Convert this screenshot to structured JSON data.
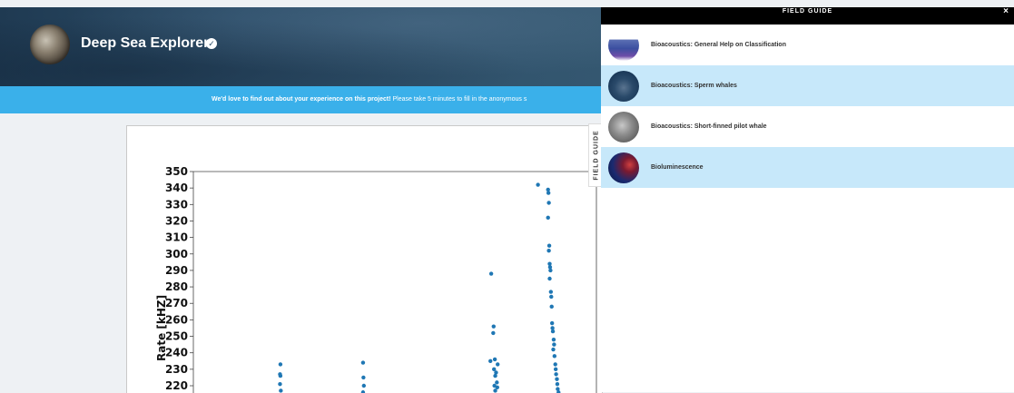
{
  "header": {
    "project_title": "Deep Sea Explorers",
    "verified_icon": "check-circle-icon"
  },
  "banner": {
    "bold_text": "We'd love to find out about your experience on this project!",
    "text": " Please take 5 minutes to fill in the anonymous s"
  },
  "field_guide_tab": {
    "label": "FIELD GUIDE"
  },
  "field_guide": {
    "title": "FIELD GUIDE",
    "close_label": "×",
    "items": [
      {
        "label": "Bioacoustics: General Help on Classification"
      },
      {
        "label": "Bioacoustics: Sperm whales"
      },
      {
        "label": "Bioacoustics: Short-finned pilot whale"
      },
      {
        "label": "Bioluminescence"
      }
    ]
  },
  "colors": {
    "banner": "#3ab0ea",
    "point": "#1f77b4",
    "highlight_row": "#c7e8fa"
  },
  "chart_data": {
    "type": "scatter",
    "ylabel": "Rate [kHZ]",
    "xlabel": "",
    "yticks": [
      220,
      230,
      240,
      250,
      260,
      270,
      280,
      290,
      300,
      310,
      320,
      330,
      340,
      350
    ],
    "ylim": [
      214,
      350
    ],
    "xlim": [
      0,
      100
    ],
    "series": [
      {
        "points": [
          [
            21.6,
            233
          ],
          [
            21.5,
            227
          ],
          [
            21.6,
            226
          ],
          [
            21.5,
            221
          ],
          [
            21.7,
            217
          ],
          [
            42.1,
            234
          ],
          [
            42.2,
            225
          ],
          [
            42.3,
            220
          ],
          [
            42.1,
            216
          ],
          [
            73.9,
            288
          ],
          [
            74.5,
            256
          ],
          [
            74.4,
            252
          ],
          [
            73.7,
            235
          ],
          [
            74.8,
            236
          ],
          [
            75.5,
            233
          ],
          [
            74.6,
            230
          ],
          [
            75.1,
            228
          ],
          [
            74.9,
            226
          ],
          [
            75.3,
            222
          ],
          [
            74.7,
            220
          ],
          [
            75.4,
            219
          ],
          [
            74.9,
            217
          ],
          [
            85.5,
            342
          ],
          [
            88.0,
            339
          ],
          [
            88.1,
            337
          ],
          [
            88.2,
            331
          ],
          [
            88.0,
            322
          ],
          [
            88.3,
            305
          ],
          [
            88.2,
            302
          ],
          [
            88.4,
            294
          ],
          [
            88.5,
            292
          ],
          [
            88.6,
            290
          ],
          [
            88.4,
            285
          ],
          [
            88.7,
            277
          ],
          [
            88.8,
            274
          ],
          [
            88.9,
            268
          ],
          [
            89.0,
            258
          ],
          [
            89.1,
            255
          ],
          [
            89.2,
            253
          ],
          [
            89.4,
            248
          ],
          [
            89.5,
            245
          ],
          [
            89.3,
            242
          ],
          [
            89.6,
            238
          ],
          [
            89.8,
            233
          ],
          [
            89.9,
            230
          ],
          [
            90.0,
            227
          ],
          [
            90.2,
            224
          ],
          [
            90.3,
            221
          ],
          [
            90.4,
            218
          ],
          [
            90.6,
            216
          ]
        ]
      }
    ]
  }
}
